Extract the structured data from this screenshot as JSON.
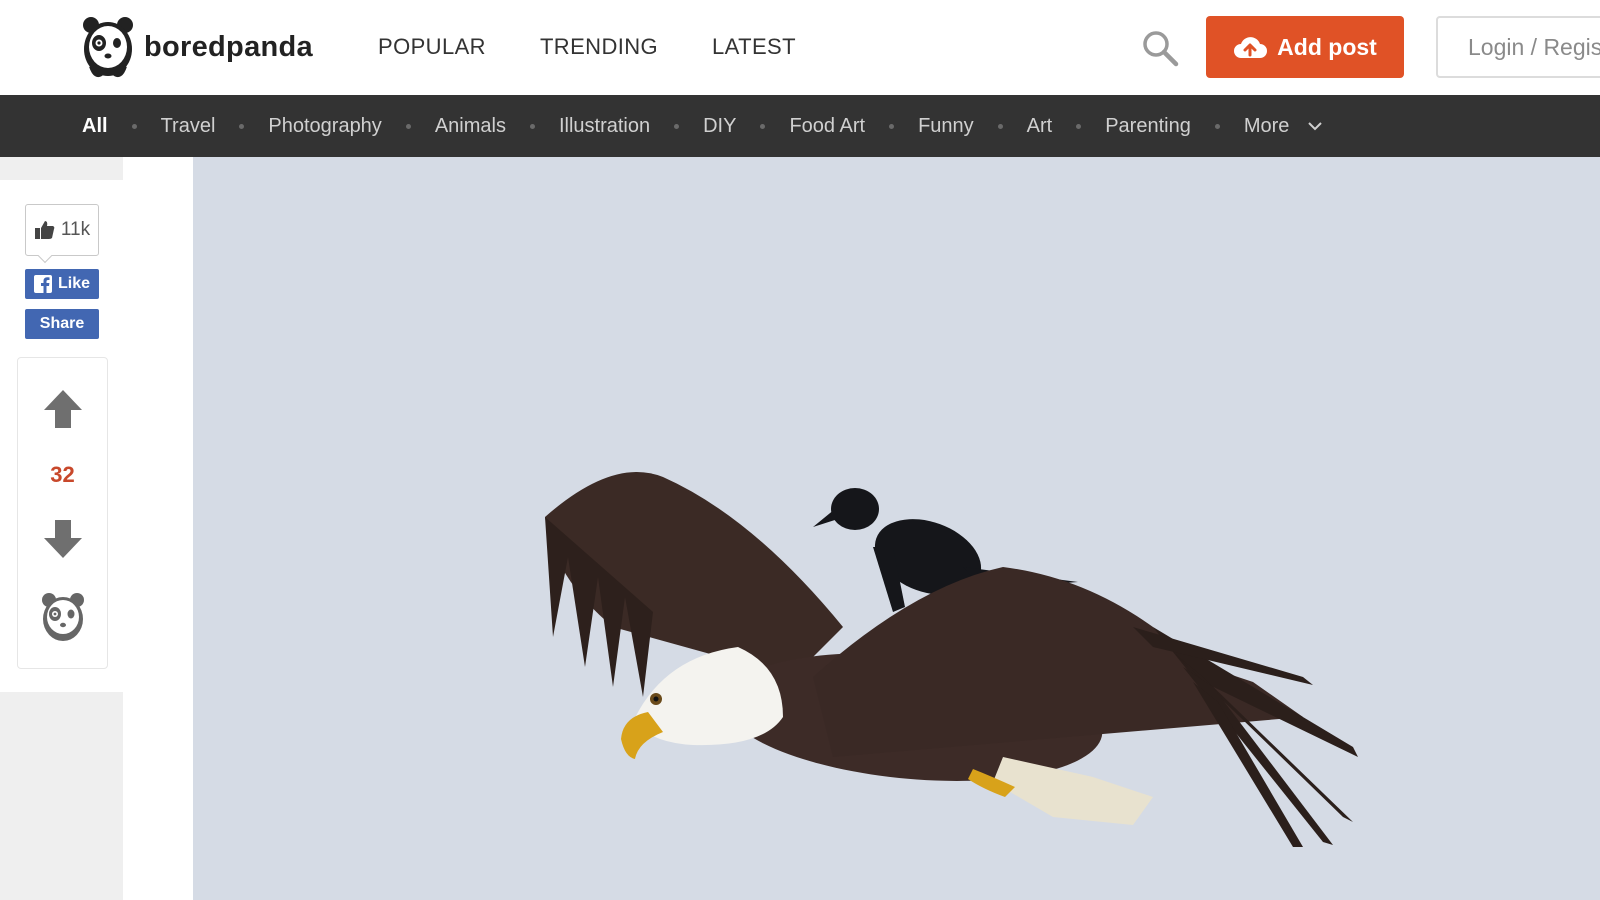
{
  "header": {
    "logo_text": "boredpanda",
    "nav": [
      "POPULAR",
      "TRENDING",
      "LATEST"
    ],
    "add_post_label": "Add post",
    "login_label": "Login / Register"
  },
  "categories": {
    "items": [
      "All",
      "Travel",
      "Photography",
      "Animals",
      "Illustration",
      "DIY",
      "Food Art",
      "Funny",
      "Art",
      "Parenting",
      "More"
    ],
    "active": "All"
  },
  "sidebar": {
    "fb_like_count": "11k",
    "fb_like_label": "Like",
    "fb_share_label": "Share",
    "vote_count": "32"
  },
  "colors": {
    "accent": "#e05226",
    "category_bar": "#333333",
    "facebook": "#4267b2",
    "vote_count": "#c8482b",
    "sky": "#d5dbe5"
  },
  "icons": [
    "panda-logo-icon",
    "search-icon",
    "cloud-upload-icon",
    "thumbs-up-icon",
    "facebook-icon",
    "arrow-up-icon",
    "arrow-down-icon",
    "panda-icon",
    "chevron-down-icon"
  ]
}
